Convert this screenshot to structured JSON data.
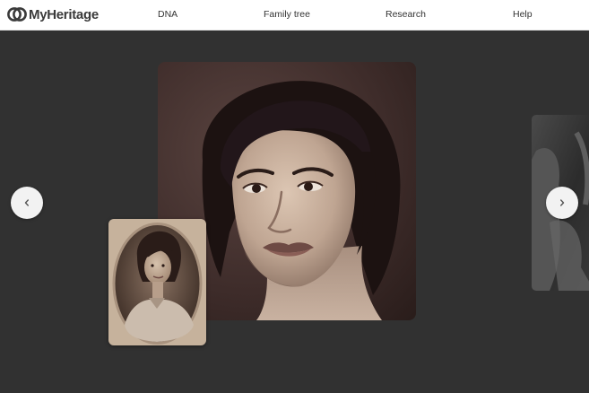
{
  "header": {
    "logo_text": "MyHeritage",
    "logo_icon": "myheritage-logo-icon",
    "nav": [
      {
        "label": "DNA"
      },
      {
        "label": "Family tree"
      },
      {
        "label": "Research"
      },
      {
        "label": "Help"
      }
    ]
  },
  "carousel": {
    "prev_icon": "chevron-left-icon",
    "next_icon": "chevron-right-icon",
    "slides": [
      {
        "kind": "enhanced-portrait",
        "active": true
      },
      {
        "kind": "next-photo",
        "active": false
      }
    ],
    "original_thumbnail": {
      "kind": "original-oval-portrait"
    }
  },
  "colors": {
    "page_background": "#313131",
    "header_background": "#ffffff",
    "nav_text": "#333333",
    "logo_text": "#3a3a3a",
    "arrow_button": "#f2f2f2",
    "sepia_dark": "#2a1d1a",
    "sepia_light": "#c9b6a4"
  }
}
